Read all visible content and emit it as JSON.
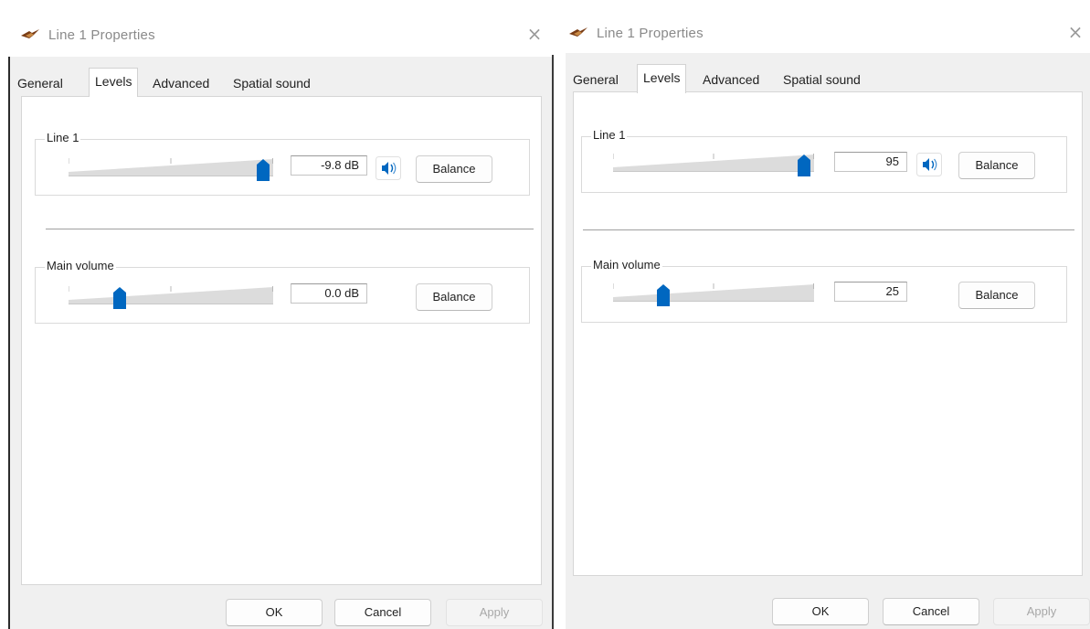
{
  "left_dialog": {
    "title": "Line 1 Properties",
    "close_glyph": "×",
    "tabs": [
      {
        "label": "General",
        "active": false
      },
      {
        "label": "Levels",
        "active": true
      },
      {
        "label": "Advanced",
        "active": false
      },
      {
        "label": "Spatial sound",
        "active": false
      }
    ],
    "line1": {
      "label": "Line 1",
      "value_text": "-9.8 dB",
      "slider_level_percent": 95,
      "balance_label": "Balance"
    },
    "main_volume": {
      "label": "Main volume",
      "value_text": "0.0 dB",
      "slider_level_percent": 25,
      "balance_label": "Balance"
    },
    "footer": {
      "ok": "OK",
      "cancel": "Cancel",
      "apply": "Apply"
    }
  },
  "right_dialog": {
    "title": "Line 1 Properties",
    "close_glyph": "×",
    "tabs": [
      {
        "label": "General",
        "active": false
      },
      {
        "label": "Levels",
        "active": true
      },
      {
        "label": "Advanced",
        "active": false
      },
      {
        "label": "Spatial sound",
        "active": false
      }
    ],
    "line1": {
      "label": "Line 1",
      "value_text": "95",
      "slider_level_percent": 95,
      "balance_label": "Balance"
    },
    "main_volume": {
      "label": "Main volume",
      "value_text": "25",
      "slider_level_percent": 25,
      "balance_label": "Balance"
    },
    "footer": {
      "ok": "OK",
      "cancel": "Cancel",
      "apply": "Apply"
    }
  },
  "colors": {
    "accent": "#0067c0",
    "track": "#dcdcdc",
    "panel_bg": "#f0f0f0",
    "title_text": "#8a8a8a"
  },
  "icons": {
    "app": "speaker-jack-icon",
    "close": "close-icon",
    "mute": "speaker-icon",
    "slider_thumb": "slider-thumb-icon"
  }
}
